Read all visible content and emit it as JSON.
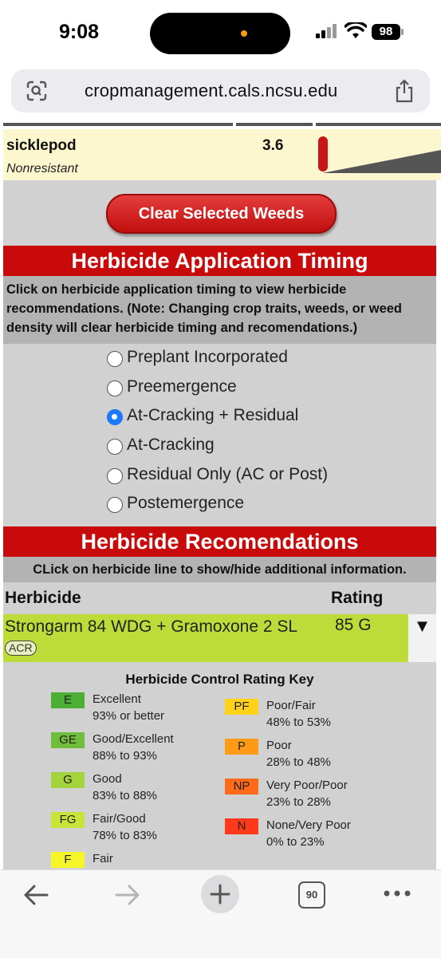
{
  "status_bar": {
    "time": "9:08",
    "battery": "98"
  },
  "browser": {
    "url": "cropmanagement.cals.ncsu.edu",
    "tab_count": "90"
  },
  "weed": {
    "name": "sicklepod",
    "resistance": "Nonresistant",
    "density": "3.6"
  },
  "clear_button": "Clear Selected Weeds",
  "timing": {
    "header": "Herbicide Application Timing",
    "description": "Click on herbicide application timing to view herbicide recommendations. (Note: Changing crop traits, weeds, or weed density will clear herbicide timing and recomendations.)",
    "options": [
      {
        "label": "Preplant Incorporated",
        "selected": false
      },
      {
        "label": "Preemergence",
        "selected": false
      },
      {
        "label": "At-Cracking + Residual",
        "selected": true
      },
      {
        "label": "At-Cracking",
        "selected": false
      },
      {
        "label": "Residual Only (AC or Post)",
        "selected": false
      },
      {
        "label": "Postemergence",
        "selected": false
      }
    ]
  },
  "recommendations": {
    "header": "Herbicide Recomendations",
    "instruction": "CLick on herbicide line to show/hide additional information.",
    "col_herbicide": "Herbicide",
    "col_rating": "Rating",
    "rows": [
      {
        "name": "Strongarm 84 WDG + Gramoxone 2 SL",
        "badge": "ACR",
        "rating": "85 G",
        "toggle": "▼"
      }
    ]
  },
  "rating_key": {
    "title": "Herbicide Control Rating Key",
    "items": [
      {
        "code": "E",
        "label": "Excellent",
        "range": "93% or better",
        "color": "#4caf33"
      },
      {
        "code": "GE",
        "label": "Good/Excellent",
        "range": "88% to 93%",
        "color": "#6fbd3a"
      },
      {
        "code": "G",
        "label": "Good",
        "range": "83% to 88%",
        "color": "#a4d43c"
      },
      {
        "code": "FG",
        "label": "Fair/Good",
        "range": "78% to 83%",
        "color": "#c8e33a"
      },
      {
        "code": "F",
        "label": "Fair",
        "range": "",
        "color": "#f5f52a"
      },
      {
        "code": "PF",
        "label": "Poor/Fair",
        "range": "48% to 53%",
        "color": "#ffd21a"
      },
      {
        "code": "P",
        "label": "Poor",
        "range": "28% to 48%",
        "color": "#ff9a16"
      },
      {
        "code": "NP",
        "label": "Very Poor/Poor",
        "range": "23% to 28%",
        "color": "#ff6a1a"
      },
      {
        "code": "N",
        "label": "None/Very Poor",
        "range": "0% to 23%",
        "color": "#ff3a1a"
      }
    ]
  }
}
